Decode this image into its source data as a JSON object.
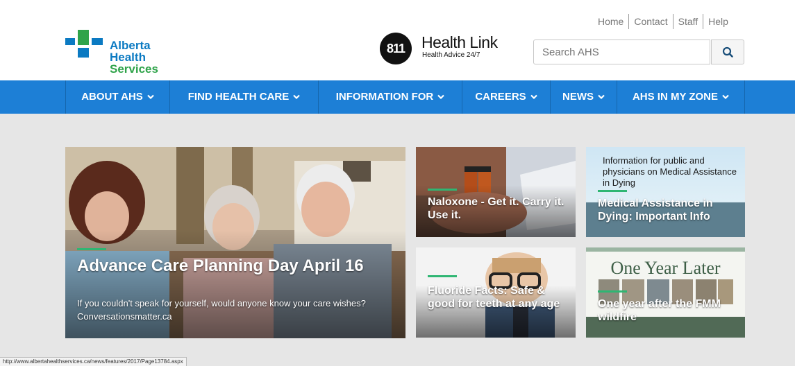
{
  "header": {
    "logo": {
      "line1": "Alberta Health",
      "line2": "Services",
      "colors": {
        "blue": "#0b7ac2",
        "green": "#2fa34a"
      }
    },
    "health_link": {
      "badge": "811",
      "title": "Health Link",
      "subtitle": "Health Advice 24/7"
    },
    "top_links": [
      "Home",
      "Contact",
      "Staff",
      "Help"
    ],
    "search": {
      "placeholder": "Search AHS",
      "icon": "search-icon"
    }
  },
  "nav": {
    "items": [
      {
        "label": "ABOUT AHS"
      },
      {
        "label": "FIND HEALTH CARE"
      },
      {
        "label": "INFORMATION FOR"
      },
      {
        "label": "CAREERS"
      },
      {
        "label": "NEWS"
      },
      {
        "label": "AHS IN MY ZONE"
      }
    ],
    "chevron_icon": "chevron-down-icon",
    "color": "#1d7fd6"
  },
  "features": {
    "main": {
      "title": "Advance Care Planning Day April 16",
      "text": "If you couldn't speak for yourself, would anyone know your care wishes? Conversationsmatter.ca"
    },
    "tiles": [
      {
        "title": "Naloxone - Get it. Carry it. Use it."
      },
      {
        "title": "Medical Assistance in Dying: Important Info",
        "overlay": "Information for public and physicians on Medical Assistance in Dying"
      },
      {
        "title": "Fluoride Facts: Safe & good for teeth at any age"
      },
      {
        "title": "One year after the FMM wildfire",
        "overlay": "One Year Later"
      }
    ],
    "accent_color": "#2fb673"
  },
  "status_bar": {
    "url": "http://www.albertahealthservices.ca/news/features/2017/Page13784.aspx"
  }
}
